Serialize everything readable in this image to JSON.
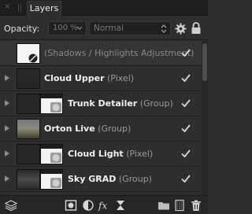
{
  "panel": {
    "close_glyph": "×",
    "tab_label": "Layers"
  },
  "options": {
    "opacity_label": "Opacity:",
    "opacity_value": "100 %",
    "blend_mode": "Normal"
  },
  "layers": [
    {
      "name": "(Shadows / Highlights Adjustment)",
      "kind": "",
      "visible": true
    },
    {
      "name": "Cloud Upper",
      "kind": "(Pixel)",
      "visible": true
    },
    {
      "name": "Trunk Detailer",
      "kind": "(Group)",
      "visible": true
    },
    {
      "name": "Orton Live",
      "kind": "(Group)",
      "visible": true
    },
    {
      "name": "Cloud Light",
      "kind": "(Pixel)",
      "visible": true
    },
    {
      "name": "Sky GRAD",
      "kind": "(Group)",
      "visible": true
    }
  ],
  "colors": {
    "panel_bg": "#2e2e2e",
    "titlebar_bg": "#1e1e1e",
    "field_bg": "#1f1f1f",
    "text": "#f2f2f2",
    "muted": "#9a9a9a"
  },
  "icons": [
    "stack-layers-icon",
    "mask-icon",
    "adjustments-icon",
    "fx-icon",
    "live-filter-icon",
    "folder-icon",
    "new-layer-icon",
    "trash-icon",
    "gear-icon",
    "lock-icon",
    "checkmark-icon",
    "chevron-down-icon",
    "updown-icon"
  ]
}
